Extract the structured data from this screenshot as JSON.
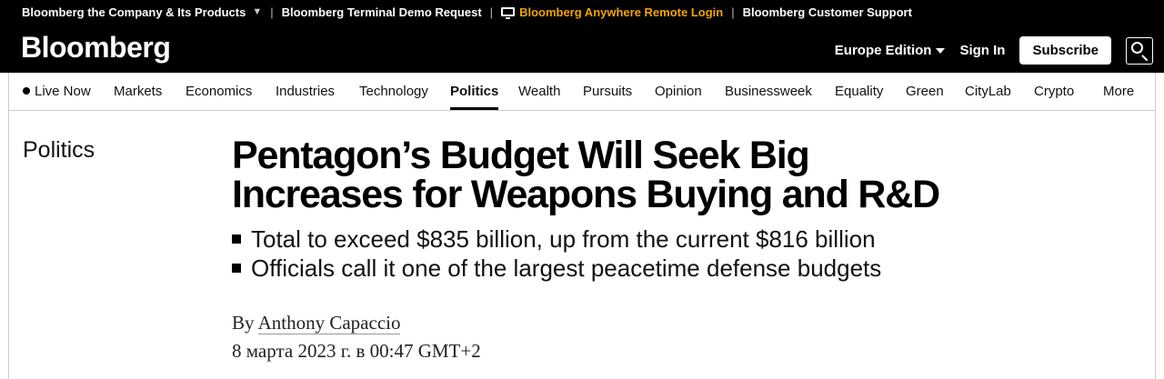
{
  "utility": {
    "company": "Bloomberg the Company & Its Products",
    "demo": "Bloomberg Terminal Demo Request",
    "remote": "Bloomberg Anywhere Remote Login",
    "support": "Bloomberg Customer Support"
  },
  "header": {
    "logo": "Bloomberg",
    "edition": "Europe Edition",
    "signin": "Sign In",
    "subscribe": "Subscribe"
  },
  "nav": {
    "items": [
      "Live Now",
      "Markets",
      "Economics",
      "Industries",
      "Technology",
      "Politics",
      "Wealth",
      "Pursuits",
      "Opinion",
      "Businessweek",
      "Equality",
      "Green",
      "CityLab",
      "Crypto",
      "More"
    ],
    "active": "Politics"
  },
  "article": {
    "section": "Politics",
    "headline_line1": "Pentagon’s Budget Will Seek Big",
    "headline_line2": "Increases for Weapons Buying and R&D",
    "bullets": [
      "Total to exceed $835 billion, up from the current $816 billion",
      "Officials call it one of the largest peacetime defense budgets"
    ],
    "by": "By",
    "author": "Anthony Capaccio",
    "date": "8 марта 2023 г. в 00:47 GMT+2"
  },
  "colors": {
    "topbar_bg": "#000000",
    "accent_remote": "#f0a500"
  }
}
